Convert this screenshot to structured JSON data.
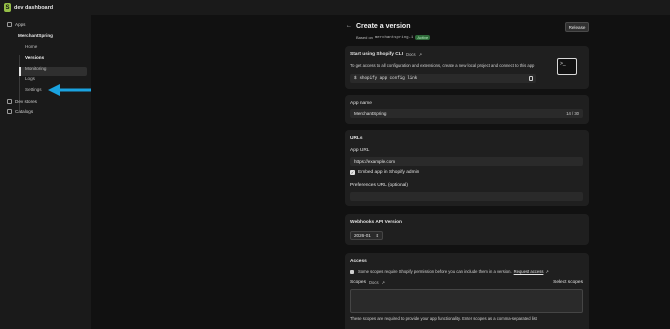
{
  "topbar": {
    "title": "dev dashboard"
  },
  "sidebar": {
    "apps_label": "Apps",
    "app_name": "MerchantSpring",
    "items": [
      {
        "label": "Home"
      },
      {
        "label": "Versions"
      },
      {
        "label": "Monitoring"
      },
      {
        "label": "Logs"
      },
      {
        "label": "Settings"
      }
    ],
    "dev_stores": "Dev stores",
    "catalogs": "Catalogs"
  },
  "header": {
    "title": "Create a version",
    "based_on": "Based on",
    "version": "merchantspring-1",
    "status": "Active",
    "release_button": "Release"
  },
  "cli_card": {
    "title": "Start using Shopify CLI",
    "docs": "Docs",
    "description": "To get access to all configuration and extensions, create a new local project and connect to this app",
    "command": "shopify app config link",
    "prompt": "$"
  },
  "app_name_card": {
    "label": "App name",
    "value": "MerchantSpring",
    "counter": "14 / 30"
  },
  "urls_card": {
    "title": "URLs",
    "app_url_label": "App URL",
    "app_url_value": "https://example.com",
    "embed_label": "Embed app in Shopify admin",
    "preferences_label": "Preferences URL (optional)"
  },
  "webhooks_card": {
    "title": "Webhooks API Version",
    "selected": "2026-01"
  },
  "access_card": {
    "title": "Access",
    "notice": "Some scopes require Shopify permission before you can include them in a version.",
    "request_access": "Request access",
    "scopes_label": "Scopes",
    "docs": "Docs",
    "select_scopes": "Select scopes",
    "help": "These scopes are required to provide your app functionality. Enter scopes as a comma-separated list"
  },
  "colors": {
    "accent": "#95bf47",
    "active_badge": "#2f6b3a",
    "arrow": "#1aa3e0"
  }
}
